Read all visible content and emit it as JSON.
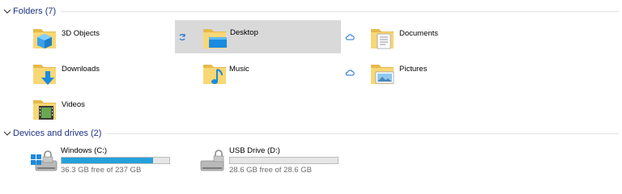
{
  "folders_group": {
    "title": "Folders (7)"
  },
  "folders": [
    {
      "name": "3D Objects",
      "icon": "3d-objects-icon"
    },
    {
      "name": "Desktop",
      "icon": "desktop-folder-icon",
      "selected": true
    },
    {
      "name": "Documents",
      "icon": "documents-folder-icon"
    },
    {
      "name": "Downloads",
      "icon": "downloads-folder-icon"
    },
    {
      "name": "Music",
      "icon": "music-folder-icon"
    },
    {
      "name": "Pictures",
      "icon": "pictures-folder-icon"
    },
    {
      "name": "Videos",
      "icon": "videos-folder-icon"
    }
  ],
  "devices_group": {
    "title": "Devices and drives (2)"
  },
  "drives": [
    {
      "name": "Windows  (C:)",
      "free_text": "36.3 GB free of 237 GB",
      "used_fraction": 0.847,
      "icon": "windows-drive-icon"
    },
    {
      "name": "USB Drive (D:)",
      "free_text": "28.6 GB free of 28.6 GB",
      "used_fraction": 0.0,
      "icon": "usb-drive-icon"
    }
  ],
  "colors": {
    "group_title": "#1e3287",
    "selection": "#d9d9d9",
    "bar_fill": "#26a0da",
    "folder_yellow": "#f8d775",
    "sync_blue": "#1e6fd4"
  }
}
